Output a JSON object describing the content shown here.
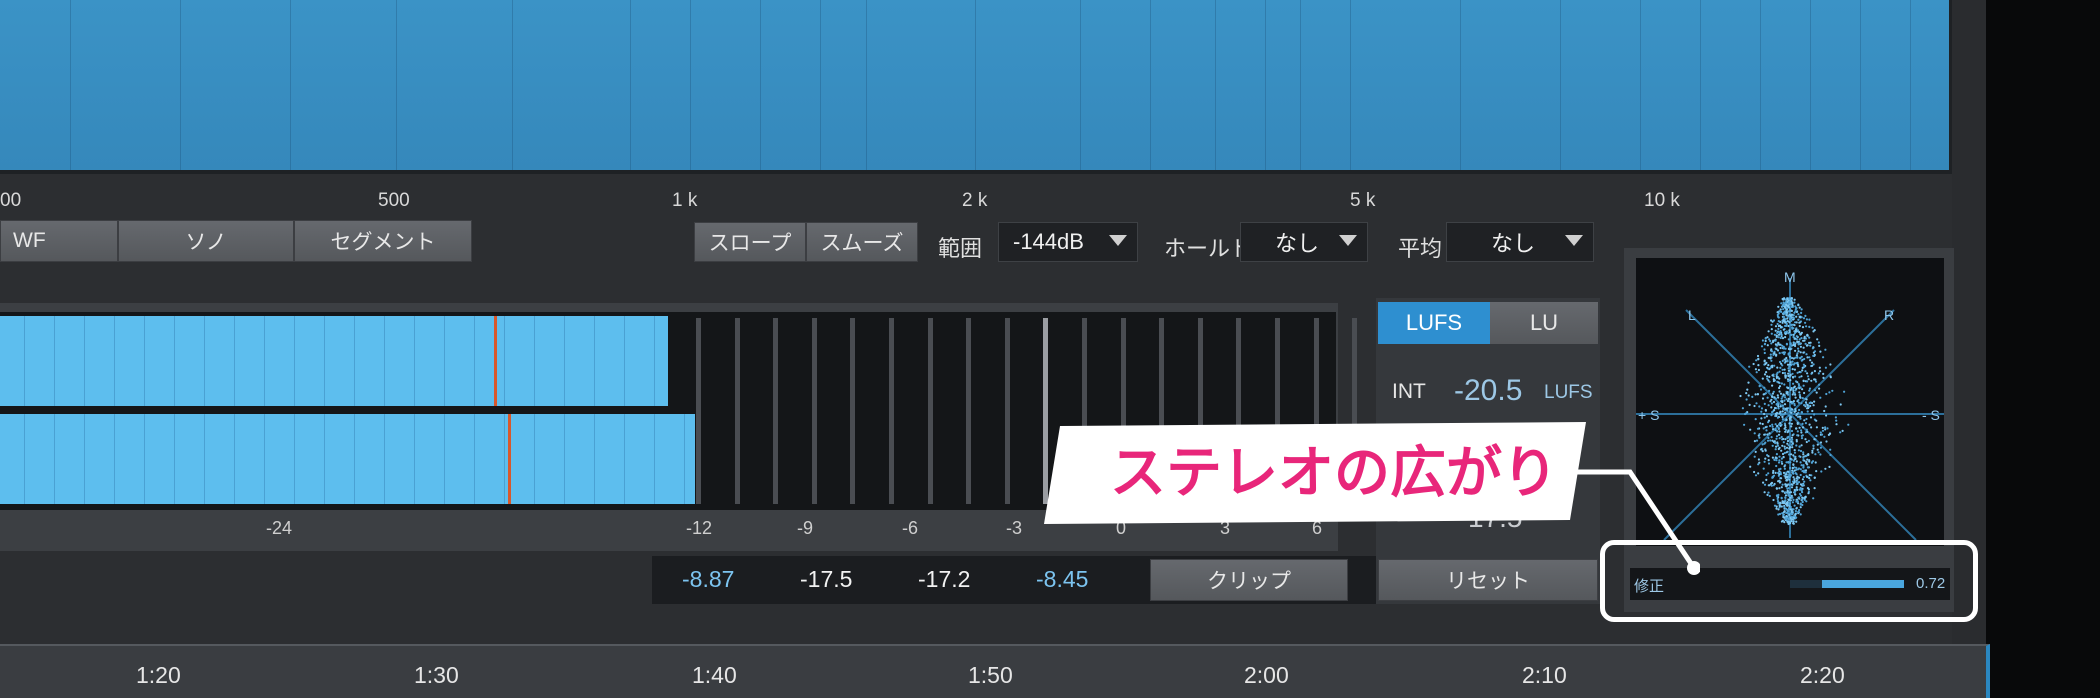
{
  "spectrum": {
    "freq_labels": [
      "00",
      "500",
      "1 k",
      "2 k",
      "5 k",
      "10 k"
    ]
  },
  "view_buttons": [
    "WF",
    "ソノ",
    "セグメント"
  ],
  "controls": {
    "slope_label": "スロープ",
    "smooth_label": "スムーズ",
    "range_label": "範囲",
    "range_value": "-144dB",
    "hold_label": "ホールド",
    "hold_value": "なし",
    "average_label": "平均",
    "average_value": "なし"
  },
  "meter": {
    "level_upper_fraction": 0.5,
    "level_lower_fraction": 0.52,
    "peak_upper_fraction": 0.37,
    "peak_lower_fraction": 0.38,
    "scale_labels": [
      "-24",
      "-12",
      "-9",
      "-6",
      "-3",
      "0",
      "3",
      "6"
    ],
    "readouts": [
      {
        "value": "-8.87",
        "color": "#7cc4f0"
      },
      {
        "value": "-17.5",
        "color": "#f2f2f2"
      },
      {
        "value": "-17.2",
        "color": "#f2f2f2"
      },
      {
        "value": "-8.45",
        "color": "#7cc4f0"
      }
    ],
    "clip_label": "クリップ"
  },
  "loudness": {
    "lufs_tab": "LUFS",
    "lu_tab": "LU",
    "int_label": "INT",
    "int_value": "-20.5",
    "int_unit": "LUFS",
    "partial_value": "17.5",
    "reset_label": "リセット"
  },
  "scope": {
    "labels": {
      "m": "M",
      "l": "L",
      "r": "R",
      "plus_s": "+ S",
      "minus_s": "- S"
    },
    "correction_label": "修正",
    "correction_value": "0.72",
    "correction_fraction": 0.72
  },
  "callout": {
    "text": "ステレオの広がり",
    "text_color": "#e8267a"
  },
  "timeline": {
    "labels": [
      "1:20",
      "1:30",
      "1:40",
      "1:50",
      "2:00",
      "2:10",
      "2:20"
    ]
  },
  "colors": {
    "accent": "#2e8fd0",
    "meter_fill": "#5dbeee",
    "peak": "#d8582c"
  }
}
